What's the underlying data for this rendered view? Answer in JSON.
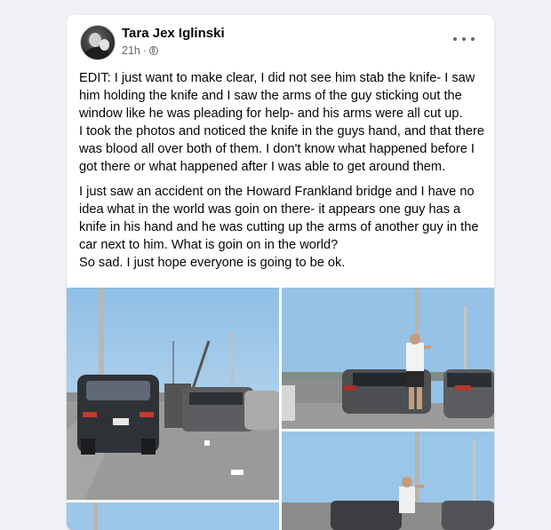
{
  "post": {
    "author": "Tara Jex Iglinski",
    "timestamp": "21h",
    "privacy_icon": "globe-icon",
    "more_icon": "more-options-icon",
    "text": [
      "EDIT: I just want to make clear, I did not see him stab the knife- I saw him holding the knife and I saw the arms of the guy sticking out the window like he was pleading for help- and his arms were all cut up.\nI took the photos and noticed the knife in the guys hand, and that there was blood all over both of them.  I don't know what happened before I got there or what happened after I was able to get around them.",
      "I just saw an accident on the Howard Frankland bridge and I have no idea what in the world was goin on there- it appears one guy has a knife in his hand and he was cutting up the arms of another guy in the car next to him. What is goin on in the world?\nSo sad. I just hope everyone is going to be ok."
    ],
    "photo_count": 4
  },
  "colors": {
    "background": "#f0f2f5",
    "card": "#ffffff",
    "secondary_text": "#65676b",
    "primary_text": "#050505"
  }
}
